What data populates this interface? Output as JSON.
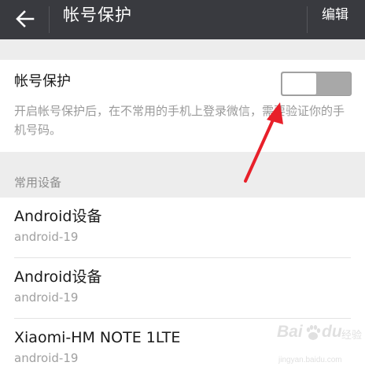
{
  "header": {
    "back_icon": "back-arrow-icon",
    "title": "帐号保护",
    "edit_label": "编辑",
    "background": "#393a3f"
  },
  "protection": {
    "label": "帐号保护",
    "toggle_state": "off",
    "description": "开启帐号保护后，在不常用的手机上登录微信，需要验证你的手机号码。"
  },
  "devices": {
    "section_title": "常用设备",
    "items": [
      {
        "name": "Android设备",
        "subtitle": "android-19"
      },
      {
        "name": "Android设备",
        "subtitle": "android-19"
      },
      {
        "name": "Xiaomi-HM NOTE 1LTE",
        "subtitle": "android-19"
      }
    ]
  },
  "annotation": {
    "arrow_color": "#e8202a"
  },
  "watermark": {
    "brand": "Baidu",
    "label": "经验",
    "url": "jingyan.baidu.com"
  }
}
